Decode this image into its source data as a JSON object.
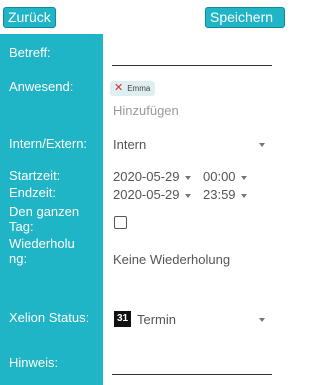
{
  "toolbar": {
    "back_label": "Zurück",
    "save_label": "Speichern"
  },
  "fields": {
    "betreff": {
      "label": "Betreff:",
      "value": ""
    },
    "anwesend": {
      "label": "Anwesend:",
      "chip": "Emma",
      "add_placeholder": "Hinzufügen"
    },
    "intern_extern": {
      "label": "Intern/Extern:",
      "value": "Intern"
    },
    "startzeit": {
      "label": "Startzeit:",
      "date": "2020-05-29",
      "time": "00:00"
    },
    "endzeit": {
      "label": "Endzeit:",
      "date": "2020-05-29",
      "time": "23:59"
    },
    "ganzer_tag": {
      "label_line1": "Den ganzen",
      "label_line2": "Tag:",
      "checked": false
    },
    "wiederholung": {
      "label_line1": "Wiederholu",
      "label_line2": "ng:",
      "value": "Keine Wiederholung"
    },
    "status": {
      "label": "Xelion Status:",
      "badge": "31",
      "value": "Termin"
    },
    "hinweis": {
      "label": "Hinweis:",
      "value": ""
    }
  },
  "colors": {
    "accent": "#1fb4c6",
    "remove_icon": "#d32f2f"
  }
}
